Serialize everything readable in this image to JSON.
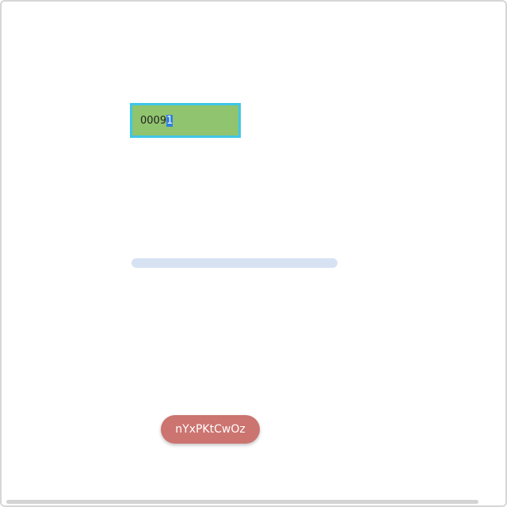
{
  "input": {
    "value_prefix": "0009",
    "value_selected": "1"
  },
  "slider": {
    "value": null
  },
  "button": {
    "label": "nYxPKtCwOz"
  }
}
